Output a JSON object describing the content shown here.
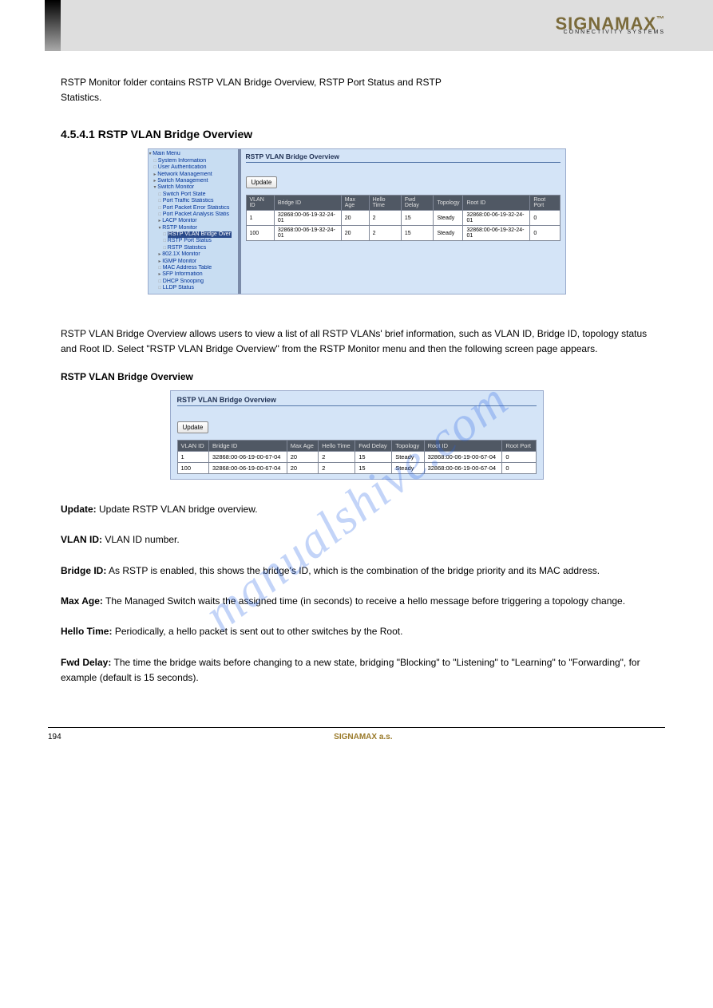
{
  "brand": {
    "name": "SIGNAMAX",
    "tag": "CONNECTIVITY SYSTEMS",
    "tm": "™"
  },
  "intro": {
    "l1": "RSTP Monitor folder contains RSTP VLAN Bridge Overview, RSTP Port Status and RSTP",
    "l2": "Statistics."
  },
  "heading": "4.5.4.1 RSTP VLAN Bridge Overview",
  "body2": "RSTP VLAN Bridge Overview allows users to view a list of all RSTP VLANs' brief information, such as VLAN ID, Bridge ID, topology status and Root ID. Select \"RSTP VLAN Bridge Overview\" from the RSTP Monitor menu and then the following screen page appears.",
  "subheading": "RSTP VLAN Bridge Overview",
  "tree": {
    "root": "Main Menu",
    "sysinfo": "System Information",
    "userauth": "User Authentication",
    "netmgmt": "Network Management",
    "swmgmt": "Switch Management",
    "swmon": "Switch Monitor",
    "sps": "Switch Port State",
    "pts": "Port Traffic Statistics",
    "ppes": "Port Packet Error Statistics",
    "ppas": "Port Packet Analysis Statis",
    "lacp": "LACP Monitor",
    "rstpmon": "RSTP Monitor",
    "rvbo": "RSTP VLAN Bridge Over",
    "rps": "RSTP Port Status",
    "rstats": "RSTP Statistics",
    "d8021x": "802.1X Monitor",
    "igmp": "IGMP Monitor",
    "mac": "MAC Address Table",
    "sfp": "SFP Information",
    "dhcp": "DHCP Snooping",
    "lldp": "LLDP Status"
  },
  "panel1": {
    "title": "RSTP VLAN Bridge Overview",
    "update": "Update",
    "headers": [
      "VLAN ID",
      "Bridge ID",
      "Max Age",
      "Hello Time",
      "Fwd Delay",
      "Topology",
      "Root ID",
      "Root Port"
    ],
    "rows": [
      {
        "vlan": "1",
        "bridge": "32868:00-06-19-32-24-01",
        "maxage": "20",
        "hello": "2",
        "fwd": "15",
        "topo": "Steady",
        "root": "32868:00-06-19-32-24-01",
        "rport": "0"
      },
      {
        "vlan": "100",
        "bridge": "32868:00-06-19-32-24-01",
        "maxage": "20",
        "hello": "2",
        "fwd": "15",
        "topo": "Steady",
        "root": "32868:00-06-19-32-24-01",
        "rport": "0"
      }
    ]
  },
  "panel2": {
    "title": "RSTP VLAN Bridge Overview",
    "update": "Update",
    "headers": [
      "VLAN ID",
      "Bridge ID",
      "Max Age",
      "Hello Time",
      "Fwd Delay",
      "Topology",
      "Root ID",
      "Root Port"
    ],
    "rows": [
      {
        "vlan": "1",
        "bridge": "32868:00-06-19-00-67-04",
        "maxage": "20",
        "hello": "2",
        "fwd": "15",
        "topo": "Steady",
        "root": "32868:00-06-19-00-67-04",
        "rport": "0"
      },
      {
        "vlan": "100",
        "bridge": "32868:00-06-19-00-67-04",
        "maxage": "20",
        "hello": "2",
        "fwd": "15",
        "topo": "Steady",
        "root": "32868:00-06-19-00-67-04",
        "rport": "0"
      }
    ]
  },
  "legend": {
    "update": "Update RSTP VLAN bridge overview.",
    "vlan": "VLAN ID number.",
    "bridge": "As RSTP is enabled, this shows the bridge's ID, which is the combination of the bridge priority and its MAC address.",
    "maxage": "The Managed Switch waits the assigned time (in seconds) to receive a hello message before triggering a topology change.",
    "hello": "Periodically, a hello packet is sent out to other switches by the Root.",
    "fwd": "The time the bridge waits before changing to a new state, bridging \"Blocking\" to \"Listening\" to \"Learning\" to \"Forwarding\", for example (default is 15 seconds)."
  },
  "labels": {
    "update": "Update:",
    "vlan": "VLAN ID:",
    "bridge": "Bridge ID:",
    "maxage": "Max Age:",
    "hello": "Hello Time:",
    "fwd": "Fwd Delay:"
  },
  "footer": {
    "left": "194",
    "center": "SIGNAMAX a.s."
  },
  "watermark": "manualshive.com"
}
